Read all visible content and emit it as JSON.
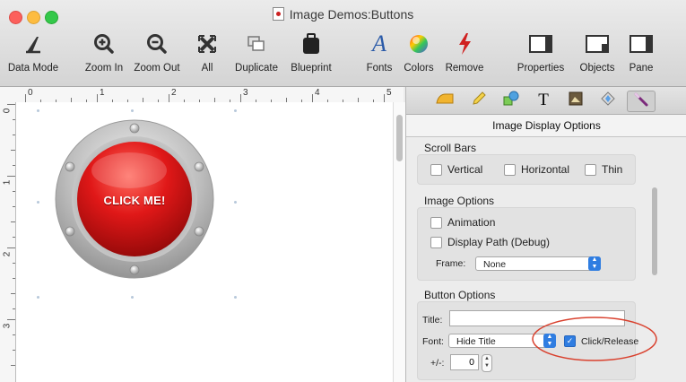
{
  "window": {
    "title": "Image Demos:Buttons"
  },
  "toolbar": {
    "items": [
      {
        "label": "Data Mode",
        "icon": "data-mode-icon"
      },
      {
        "label": "Zoom In",
        "icon": "zoom-in-icon"
      },
      {
        "label": "Zoom Out",
        "icon": "zoom-out-icon"
      },
      {
        "label": "All",
        "icon": "zoom-all-icon"
      },
      {
        "label": "Duplicate",
        "icon": "duplicate-icon"
      },
      {
        "label": "Blueprint",
        "icon": "blueprint-icon"
      },
      {
        "label": "Fonts",
        "icon": "fonts-icon"
      },
      {
        "label": "Colors",
        "icon": "colors-icon"
      },
      {
        "label": "Remove",
        "icon": "remove-icon"
      },
      {
        "label": "Properties",
        "icon": "properties-icon"
      },
      {
        "label": "Objects",
        "icon": "objects-icon"
      },
      {
        "label": "Pane",
        "icon": "pane-icon"
      }
    ]
  },
  "ruler": {
    "h_numbers": [
      "0",
      "1",
      "2",
      "3",
      "4",
      "5"
    ],
    "v_numbers": [
      "0",
      "1",
      "2",
      "3"
    ]
  },
  "canvas": {
    "button_text": "CLICK ME!"
  },
  "panel": {
    "header": "Image Display Options",
    "scroll_bars": {
      "title": "Scroll Bars",
      "vertical": "Vertical",
      "horizontal": "Horizontal",
      "thin": "Thin"
    },
    "image_options": {
      "title": "Image Options",
      "animation": "Animation",
      "display_path": "Display Path (Debug)",
      "frame_label": "Frame:",
      "frame_value": "None"
    },
    "button_options": {
      "title": "Button Options",
      "title_label": "Title:",
      "title_value": "",
      "font_label": "Font:",
      "font_value": "Hide Title",
      "click_release": "Click/Release",
      "click_release_checked": true,
      "plusminus_label": "+/-:",
      "plusminus_value": "0"
    }
  },
  "colors": {
    "accent": "#2f7de1",
    "highlight_circle": "#d9412e",
    "button_red": "#d9171b"
  }
}
